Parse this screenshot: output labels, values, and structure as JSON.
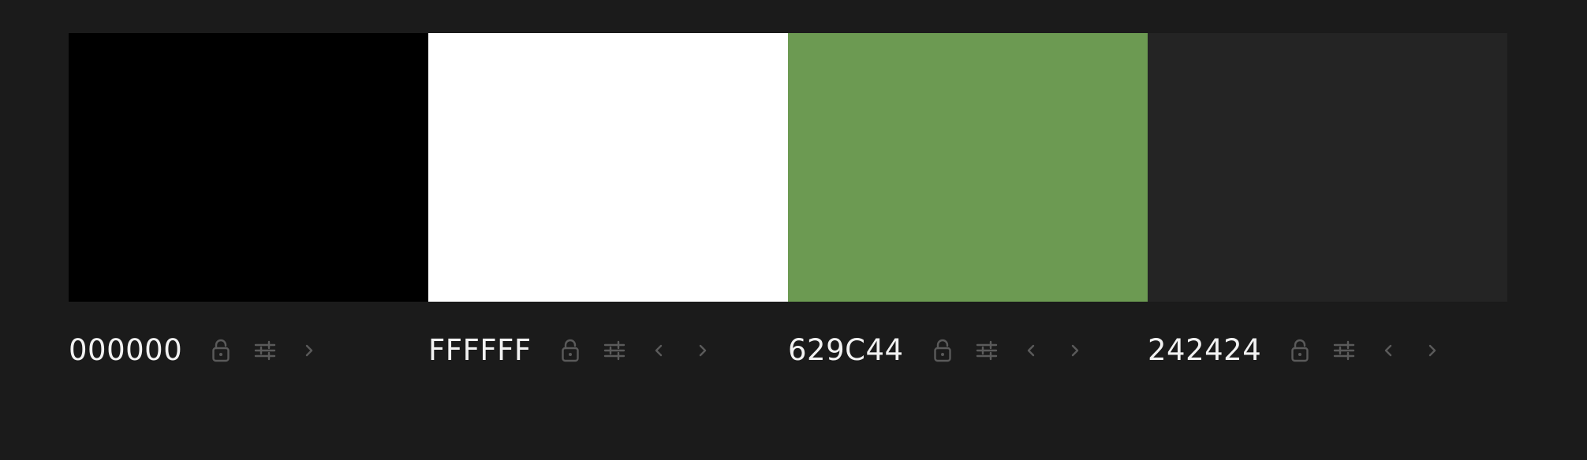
{
  "palette": {
    "swatches": [
      {
        "hex": "000000",
        "color": "#000000",
        "controls": [
          "lock-icon",
          "adjust-icon",
          "chevron-right-icon"
        ]
      },
      {
        "hex": "FFFFFF",
        "color": "#FFFFFF",
        "controls": [
          "lock-icon",
          "adjust-icon",
          "chevron-left-icon",
          "chevron-right-icon"
        ]
      },
      {
        "hex": "629C44",
        "color": "#6C9A52",
        "controls": [
          "lock-icon",
          "adjust-icon",
          "chevron-left-icon",
          "chevron-right-icon"
        ]
      },
      {
        "hex": "242424",
        "color": "#242424",
        "controls": [
          "lock-icon",
          "adjust-icon",
          "chevron-left-icon",
          "chevron-right-icon"
        ]
      }
    ]
  },
  "theme": {
    "background": "#1B1B1B",
    "text": "#F2F2F2",
    "icon": "#5A5A5A"
  }
}
